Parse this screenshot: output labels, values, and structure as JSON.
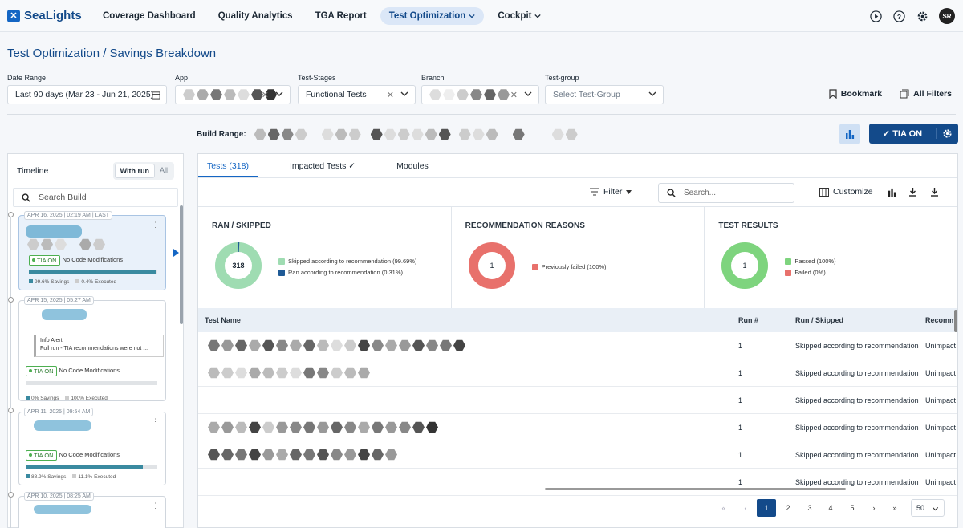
{
  "brand": {
    "name": "SeaLights",
    "color": "#134a8a"
  },
  "nav": {
    "items": [
      {
        "label": "Coverage Dashboard"
      },
      {
        "label": "Quality Analytics"
      },
      {
        "label": "TGA Report"
      },
      {
        "label": "Test Optimization",
        "active": true
      },
      {
        "label": "Cockpit"
      }
    ],
    "icons": [
      "play-icon",
      "help-icon",
      "settings-icon"
    ],
    "avatar": "SR"
  },
  "page": {
    "title": "Test Optimization / Savings Breakdown"
  },
  "filters": {
    "date_range": {
      "label": "Date Range",
      "value": "Last 90 days (Mar 23 - Jun 21, 2025)"
    },
    "app": {
      "label": "App"
    },
    "test_stages": {
      "label": "Test-Stages",
      "value": "Functional Tests"
    },
    "branch": {
      "label": "Branch"
    },
    "test_group": {
      "label": "Test-group",
      "placeholder": "Select Test-Group"
    },
    "bookmark": "Bookmark",
    "all_filters": "All Filters"
  },
  "build_range": {
    "label": "Build Range:"
  },
  "tia_button": {
    "label": "TIA ON"
  },
  "timeline": {
    "title": "Timeline",
    "toggle": [
      "With run",
      "All"
    ],
    "search_placeholder": "Search Build",
    "cards": [
      {
        "date": "APR 16, 2025 | 02:19 AM | LAST",
        "badge": "TIA ON",
        "status": "No Code Modifications",
        "savings": "99.6% Savings",
        "executed": "0.4% Executed",
        "savings_fraction": 0.996
      },
      {
        "date": "APR 15, 2025 | 05:27 AM",
        "alert_title": "Info Alert!",
        "alert_text": "Full run - TIA recommendations were not ...",
        "badge": "TIA ON",
        "status": "No Code Modifications",
        "savings": "0% Savings",
        "executed": "100% Executed",
        "savings_fraction": 0
      },
      {
        "date": "APR 11, 2025 | 09:54 AM",
        "badge": "TIA ON",
        "status": "No Code Modifications",
        "savings": "88.9% Savings",
        "executed": "11.1% Executed",
        "savings_fraction": 0.889
      },
      {
        "date": "APR 10, 2025 | 08:25 AM"
      }
    ]
  },
  "tabs": {
    "tests": "Tests (318)",
    "impacted": "Impacted Tests",
    "modules": "Modules"
  },
  "toolbar": {
    "filter": "Filter",
    "search_placeholder": "Search...",
    "customize": "Customize"
  },
  "summary": {
    "ran_skipped": {
      "title": "RAN / SKIPPED",
      "center": "318",
      "legend": [
        {
          "label": "Skipped according to recommendation (99.69%)",
          "color": "#9fdcb2",
          "fraction": 0.9969
        },
        {
          "label": "Ran according to recommendation (0.31%)",
          "color": "#1f5a96",
          "fraction": 0.0031
        }
      ]
    },
    "reasons": {
      "title": "RECOMMENDATION REASONS",
      "center": "1",
      "legend": [
        {
          "label": "Previously failed (100%)",
          "color": "#e8716c",
          "fraction": 1
        }
      ]
    },
    "results": {
      "title": "TEST RESULTS",
      "center": "1",
      "legend": [
        {
          "label": "Passed (100%)",
          "color": "#7ed47e",
          "fraction": 1
        },
        {
          "label": "Failed (0%)",
          "color": "#e8716c",
          "fraction": 0
        }
      ]
    }
  },
  "table": {
    "headers": [
      "Test Name",
      "Run #",
      "Run / Skipped",
      "Recomm"
    ],
    "rows": [
      {
        "run": "1",
        "status": "Skipped according to recommendation",
        "rec": "Unimpact"
      },
      {
        "run": "1",
        "status": "Skipped according to recommendation",
        "rec": "Unimpact"
      },
      {
        "run": "1",
        "status": "Skipped according to recommendation",
        "rec": "Unimpact"
      },
      {
        "run": "1",
        "status": "Skipped according to recommendation",
        "rec": "Unimpact"
      },
      {
        "run": "1",
        "status": "Skipped according to recommendation",
        "rec": "Unimpact"
      },
      {
        "run": "1",
        "status": "Skipped according to recommendation",
        "rec": "Unimpact"
      }
    ]
  },
  "pagination": {
    "pages": [
      "1",
      "2",
      "3",
      "4",
      "5"
    ],
    "current": "1",
    "per_page": "50"
  }
}
